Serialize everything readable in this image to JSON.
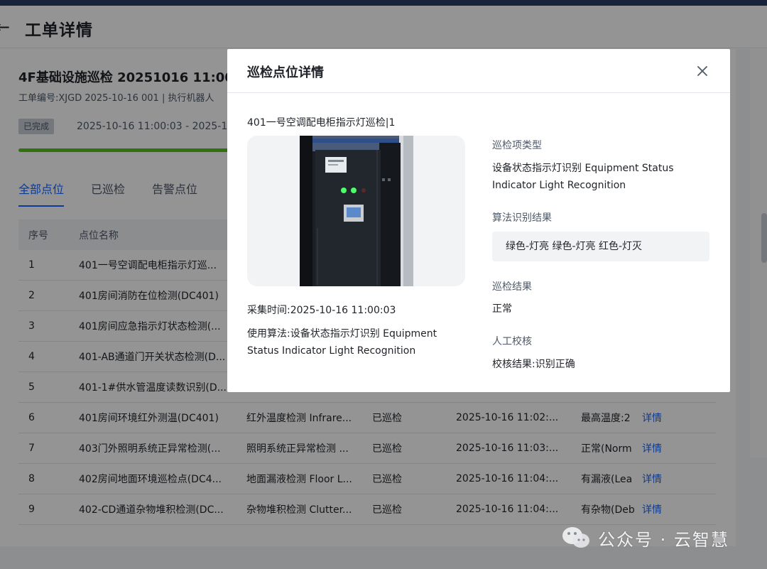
{
  "page": {
    "title": "工单详情",
    "order_title": "4F基础设施巡检 20251016 11:00",
    "order_sub": "工单编号:XJGD 2025-10-16 001 | 执行机器人",
    "status": "已完成",
    "time_range": "2025-10-16 11:00:03 - 2025-1",
    "progress": 1.0
  },
  "tabs": [
    {
      "label": "全部点位"
    },
    {
      "label": "已巡检"
    },
    {
      "label": "告警点位"
    }
  ],
  "table": {
    "headers": [
      "序号",
      "点位名称"
    ],
    "rows": [
      [
        "1",
        "401一号空调配电柜指示灯巡...",
        "",
        "",
        "",
        "",
        ""
      ],
      [
        "2",
        "401房间消防在位检测(DC401)",
        "",
        "",
        "",
        "",
        ""
      ],
      [
        "3",
        "401房间应急指示灯状态检测(...",
        "",
        "",
        "",
        "",
        ""
      ],
      [
        "4",
        "401-AB通道门开关状态检测(D...",
        "",
        "",
        "",
        "",
        ""
      ],
      [
        "5",
        "401-1#供水管温度读数识别(D...",
        "",
        "",
        "",
        "",
        ""
      ],
      [
        "6",
        "401房间环境红外测温(DC401)",
        "红外温度检测 Infrare...",
        "已巡检",
        "2025-10-16 11:02:...",
        "最高温度:2",
        "详情"
      ],
      [
        "7",
        "403门外照明系统正异常检测(...",
        "照明系统正异常检测 ...",
        "已巡检",
        "2025-10-16 11:03:...",
        "正常(Norm",
        "详情"
      ],
      [
        "8",
        "402房间地面环境巡检点(DC4...",
        "地面漏液检测 Floor L...",
        "已巡检",
        "2025-10-16 11:04:...",
        "有漏液(Lea",
        "详情"
      ],
      [
        "9",
        "402-CD通道杂物堆积检测(DC...",
        "杂物堆积检测 Clutter...",
        "已巡检",
        "2025-10-16 11:04:...",
        "有杂物(Deb",
        "详情"
      ]
    ]
  },
  "modal": {
    "title": "巡检点位详情",
    "point_name": "401一号空调配电柜指示灯巡检|1",
    "collect_time": "采集时间:2025-10-16 11:00:03",
    "algo_used": "使用算法:设备状态指示灯识别 Equipment Status Indicator Light Recognition",
    "item_type_label": "巡检项类型",
    "item_type_value": "设备状态指示灯识别 Equipment Status Indicator Light Recognition",
    "algo_result_label": "算法识别结果",
    "algo_result_value": "绿色-灯亮 绿色-灯亮 红色-灯灭",
    "inspect_result_label": "巡检结果",
    "inspect_result_value": "正常",
    "manual_check_label": "人工校核",
    "manual_check_value": "校核结果:识别正确"
  },
  "watermark": "公众号 · 云智慧",
  "colors": {
    "accent": "#1664ff",
    "success": "#52c41a",
    "topbar": "#17233b"
  }
}
